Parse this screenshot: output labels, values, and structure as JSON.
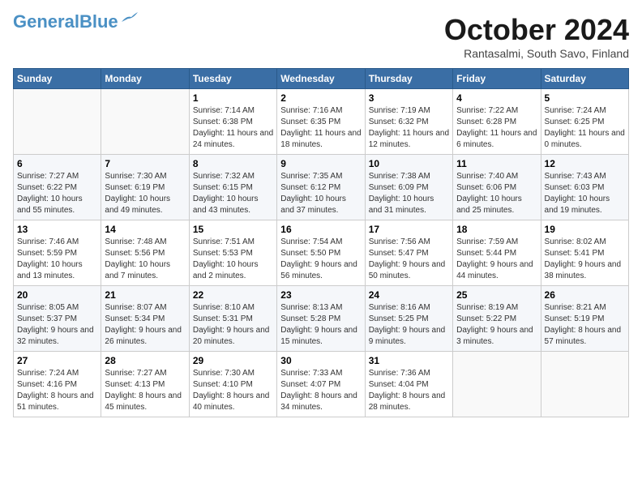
{
  "logo": {
    "line1": "General",
    "line2": "Blue"
  },
  "title": "October 2024",
  "subtitle": "Rantasalmi, South Savo, Finland",
  "days_of_week": [
    "Sunday",
    "Monday",
    "Tuesday",
    "Wednesday",
    "Thursday",
    "Friday",
    "Saturday"
  ],
  "weeks": [
    [
      {
        "day": "",
        "info": ""
      },
      {
        "day": "",
        "info": ""
      },
      {
        "day": "1",
        "info": "Sunrise: 7:14 AM\nSunset: 6:38 PM\nDaylight: 11 hours and 24 minutes."
      },
      {
        "day": "2",
        "info": "Sunrise: 7:16 AM\nSunset: 6:35 PM\nDaylight: 11 hours and 18 minutes."
      },
      {
        "day": "3",
        "info": "Sunrise: 7:19 AM\nSunset: 6:32 PM\nDaylight: 11 hours and 12 minutes."
      },
      {
        "day": "4",
        "info": "Sunrise: 7:22 AM\nSunset: 6:28 PM\nDaylight: 11 hours and 6 minutes."
      },
      {
        "day": "5",
        "info": "Sunrise: 7:24 AM\nSunset: 6:25 PM\nDaylight: 11 hours and 0 minutes."
      }
    ],
    [
      {
        "day": "6",
        "info": "Sunrise: 7:27 AM\nSunset: 6:22 PM\nDaylight: 10 hours and 55 minutes."
      },
      {
        "day": "7",
        "info": "Sunrise: 7:30 AM\nSunset: 6:19 PM\nDaylight: 10 hours and 49 minutes."
      },
      {
        "day": "8",
        "info": "Sunrise: 7:32 AM\nSunset: 6:15 PM\nDaylight: 10 hours and 43 minutes."
      },
      {
        "day": "9",
        "info": "Sunrise: 7:35 AM\nSunset: 6:12 PM\nDaylight: 10 hours and 37 minutes."
      },
      {
        "day": "10",
        "info": "Sunrise: 7:38 AM\nSunset: 6:09 PM\nDaylight: 10 hours and 31 minutes."
      },
      {
        "day": "11",
        "info": "Sunrise: 7:40 AM\nSunset: 6:06 PM\nDaylight: 10 hours and 25 minutes."
      },
      {
        "day": "12",
        "info": "Sunrise: 7:43 AM\nSunset: 6:03 PM\nDaylight: 10 hours and 19 minutes."
      }
    ],
    [
      {
        "day": "13",
        "info": "Sunrise: 7:46 AM\nSunset: 5:59 PM\nDaylight: 10 hours and 13 minutes."
      },
      {
        "day": "14",
        "info": "Sunrise: 7:48 AM\nSunset: 5:56 PM\nDaylight: 10 hours and 7 minutes."
      },
      {
        "day": "15",
        "info": "Sunrise: 7:51 AM\nSunset: 5:53 PM\nDaylight: 10 hours and 2 minutes."
      },
      {
        "day": "16",
        "info": "Sunrise: 7:54 AM\nSunset: 5:50 PM\nDaylight: 9 hours and 56 minutes."
      },
      {
        "day": "17",
        "info": "Sunrise: 7:56 AM\nSunset: 5:47 PM\nDaylight: 9 hours and 50 minutes."
      },
      {
        "day": "18",
        "info": "Sunrise: 7:59 AM\nSunset: 5:44 PM\nDaylight: 9 hours and 44 minutes."
      },
      {
        "day": "19",
        "info": "Sunrise: 8:02 AM\nSunset: 5:41 PM\nDaylight: 9 hours and 38 minutes."
      }
    ],
    [
      {
        "day": "20",
        "info": "Sunrise: 8:05 AM\nSunset: 5:37 PM\nDaylight: 9 hours and 32 minutes."
      },
      {
        "day": "21",
        "info": "Sunrise: 8:07 AM\nSunset: 5:34 PM\nDaylight: 9 hours and 26 minutes."
      },
      {
        "day": "22",
        "info": "Sunrise: 8:10 AM\nSunset: 5:31 PM\nDaylight: 9 hours and 20 minutes."
      },
      {
        "day": "23",
        "info": "Sunrise: 8:13 AM\nSunset: 5:28 PM\nDaylight: 9 hours and 15 minutes."
      },
      {
        "day": "24",
        "info": "Sunrise: 8:16 AM\nSunset: 5:25 PM\nDaylight: 9 hours and 9 minutes."
      },
      {
        "day": "25",
        "info": "Sunrise: 8:19 AM\nSunset: 5:22 PM\nDaylight: 9 hours and 3 minutes."
      },
      {
        "day": "26",
        "info": "Sunrise: 8:21 AM\nSunset: 5:19 PM\nDaylight: 8 hours and 57 minutes."
      }
    ],
    [
      {
        "day": "27",
        "info": "Sunrise: 7:24 AM\nSunset: 4:16 PM\nDaylight: 8 hours and 51 minutes."
      },
      {
        "day": "28",
        "info": "Sunrise: 7:27 AM\nSunset: 4:13 PM\nDaylight: 8 hours and 45 minutes."
      },
      {
        "day": "29",
        "info": "Sunrise: 7:30 AM\nSunset: 4:10 PM\nDaylight: 8 hours and 40 minutes."
      },
      {
        "day": "30",
        "info": "Sunrise: 7:33 AM\nSunset: 4:07 PM\nDaylight: 8 hours and 34 minutes."
      },
      {
        "day": "31",
        "info": "Sunrise: 7:36 AM\nSunset: 4:04 PM\nDaylight: 8 hours and 28 minutes."
      },
      {
        "day": "",
        "info": ""
      },
      {
        "day": "",
        "info": ""
      }
    ]
  ]
}
